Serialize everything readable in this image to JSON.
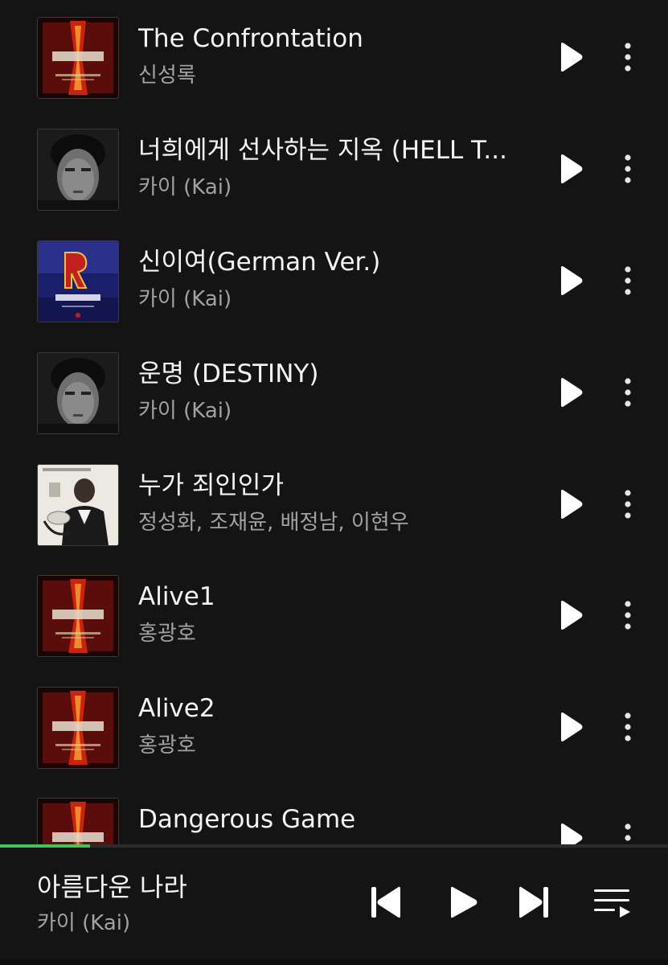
{
  "tracks": [
    {
      "title": "The Confrontation",
      "artist": "신성록",
      "cover": "jekyll-hyde-album-art"
    },
    {
      "title": "너희에게 선사하는 지옥 (HELL T...",
      "artist": "카이 (Kai)",
      "cover": "kai-portrait-album-art"
    },
    {
      "title": "신이여(German Ver.)",
      "artist": "카이 (Kai)",
      "cover": "rebecca-album-art"
    },
    {
      "title": "운명 (DESTINY)",
      "artist": "카이 (Kai)",
      "cover": "kai-portrait-album-art"
    },
    {
      "title": "누가 죄인인가",
      "artist": "정성화, 조재윤, 배정남, 이현우",
      "cover": "hero-ost-album-art"
    },
    {
      "title": "Alive1",
      "artist": "홍광호",
      "cover": "jekyll-hyde-album-art"
    },
    {
      "title": "Alive2",
      "artist": "홍광호",
      "cover": "jekyll-hyde-album-art"
    },
    {
      "title": "Dangerous Game",
      "artist": "",
      "cover": "jekyll-hyde-album-art"
    }
  ],
  "now_playing": {
    "title": "아름다운 나라",
    "artist": "카이 (Kai)",
    "progress": 0.135
  },
  "colors": {
    "background": "#141414",
    "accent_progress": "#45c35a",
    "title_text": "#f4f4f4",
    "artist_text": "#a2a2a2"
  },
  "icons": {
    "row_play": "play-icon",
    "row_more": "more-vertical-icon",
    "previous": "skip-previous-icon",
    "play": "play-icon",
    "next": "skip-next-icon",
    "queue": "queue-list-icon"
  }
}
